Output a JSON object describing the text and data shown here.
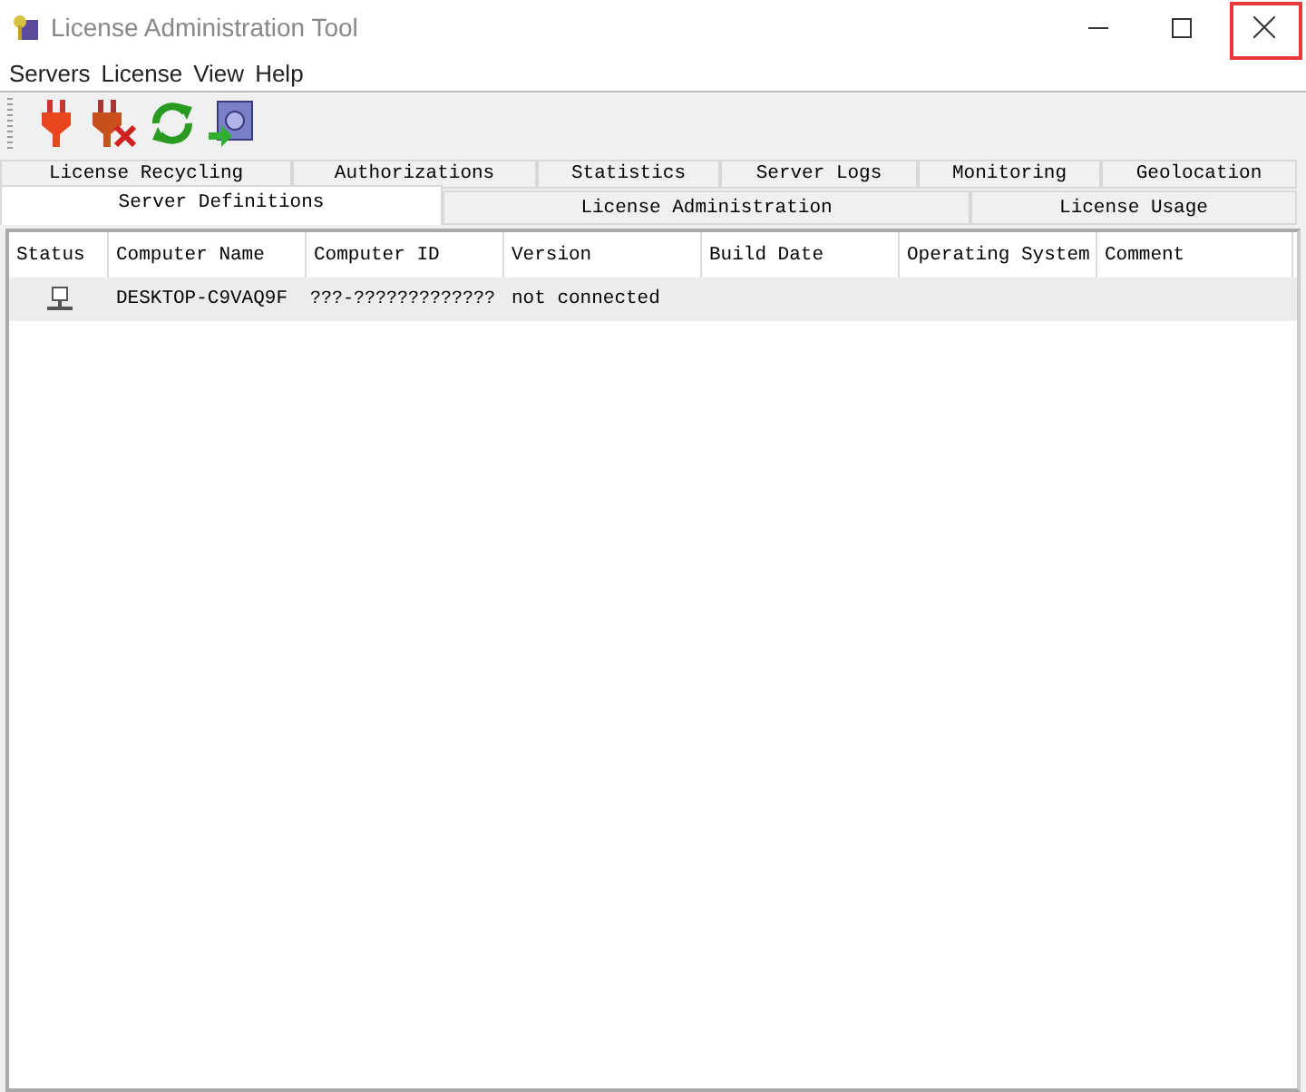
{
  "window": {
    "title": "License Administration Tool"
  },
  "menu": [
    "Servers",
    "License",
    "View",
    "Help"
  ],
  "tab_rows": [
    [
      {
        "label": "License Recycling",
        "selected": false
      },
      {
        "label": "Authorizations",
        "selected": false
      },
      {
        "label": "Statistics",
        "selected": false
      },
      {
        "label": "Server Logs",
        "selected": false
      },
      {
        "label": "Monitoring",
        "selected": false
      },
      {
        "label": "Geolocation",
        "selected": false
      }
    ],
    [
      {
        "label": "Server Definitions",
        "selected": true
      },
      {
        "label": "License Administration",
        "selected": false
      },
      {
        "label": "License Usage",
        "selected": false
      }
    ]
  ],
  "table": {
    "columns": [
      "Status",
      "Computer Name",
      "Computer ID",
      "Version",
      "Build Date",
      "Operating System",
      "Comment"
    ],
    "rows": [
      {
        "computer_name": "DESKTOP-C9VAQ9F",
        "computer_id": "???-?????????????",
        "version": "not connected",
        "selected": true
      }
    ]
  }
}
